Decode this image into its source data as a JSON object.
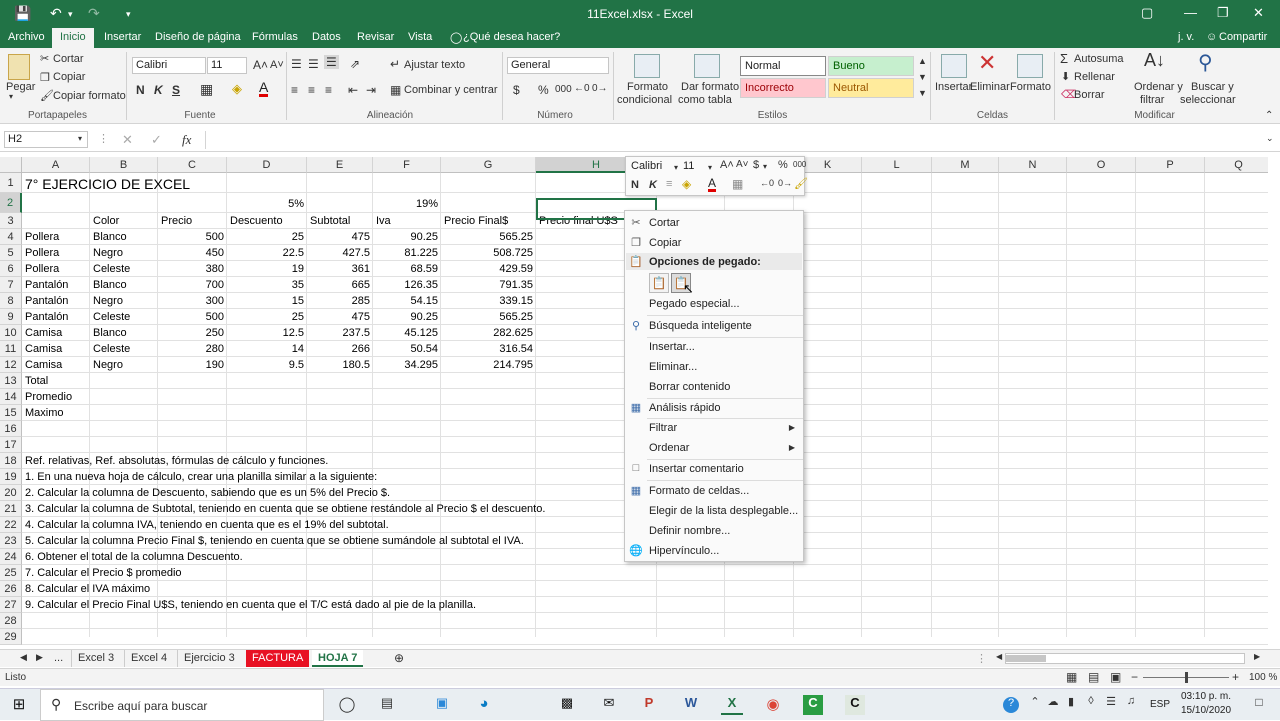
{
  "title_bar": {
    "title": "11Excel.xlsx - Excel"
  },
  "tabs": [
    "Archivo",
    "Inicio",
    "Insertar",
    "Diseño de página",
    "Fórmulas",
    "Datos",
    "Revisar",
    "Vista"
  ],
  "tell_me": "¿Qué desea hacer?",
  "user": "j. v.",
  "share": "Compartir",
  "ribbon": {
    "clipboard": {
      "paste": "Pegar",
      "cut": "Cortar",
      "copy": "Copiar",
      "format_painter": "Copiar formato",
      "group": "Portapapeles"
    },
    "font": {
      "name": "Calibri",
      "size": "11",
      "bold": "N",
      "italic": "K",
      "underline": "S",
      "group": "Fuente"
    },
    "alignment": {
      "wrap": "Ajustar texto",
      "merge": "Combinar y centrar",
      "group": "Alineación"
    },
    "number": {
      "format": "General",
      "currency": "$",
      "percent": "%",
      "thousands": "000",
      "group": "Número"
    },
    "styles": {
      "conditional": [
        "Formato",
        "condicional"
      ],
      "as_table": [
        "Dar formato",
        "como tabla"
      ],
      "normal": "Normal",
      "bueno": "Bueno",
      "incorrecto": "Incorrecto",
      "neutral": "Neutral",
      "group": "Estilos"
    },
    "cells": {
      "insert": "Insertar",
      "delete": "Eliminar",
      "format": "Formato",
      "group": "Celdas"
    },
    "editing": {
      "autosum": "Autosuma",
      "fill": "Rellenar",
      "clear": "Borrar",
      "sort": [
        "Ordenar y",
        "filtrar"
      ],
      "find": [
        "Buscar y",
        "seleccionar"
      ],
      "group": "Modificar"
    }
  },
  "formula_bar": {
    "name_box": "H2",
    "fx": "fx",
    "value": ""
  },
  "columns": [
    "A",
    "B",
    "C",
    "D",
    "E",
    "F",
    "G",
    "H",
    "I",
    "J",
    "K",
    "L",
    "M",
    "N",
    "O",
    "P",
    "Q"
  ],
  "rows": [
    "1",
    "2",
    "3",
    "4",
    "5",
    "6",
    "7",
    "8",
    "9",
    "10",
    "11",
    "12",
    "13",
    "14",
    "15",
    "16",
    "17",
    "18",
    "19",
    "20",
    "21",
    "22",
    "23",
    "24",
    "25",
    "26",
    "27",
    "28",
    "29"
  ],
  "cells": {
    "A1": "7° EJERCICIO DE EXCEL",
    "D2": "5%",
    "F2": "19%",
    "B3": "Color",
    "C3": "Precio",
    "D3": "Descuento",
    "E3": "Subtotal",
    "F3": "Iva",
    "G3": "Precio Final$",
    "H3": "Precio final U$S",
    "data": [
      [
        "Pollera",
        "Blanco",
        "500",
        "25",
        "475",
        "90.25",
        "565.25"
      ],
      [
        "Pollera",
        "Negro",
        "450",
        "22.5",
        "427.5",
        "81.225",
        "508.725"
      ],
      [
        "Pollera",
        "Celeste",
        "380",
        "19",
        "361",
        "68.59",
        "429.59"
      ],
      [
        "Pantalón",
        "Blanco",
        "700",
        "35",
        "665",
        "126.35",
        "791.35"
      ],
      [
        "Pantalón",
        "Negro",
        "300",
        "15",
        "285",
        "54.15",
        "339.15"
      ],
      [
        "Pantalón",
        "Celeste",
        "500",
        "25",
        "475",
        "90.25",
        "565.25"
      ],
      [
        "Camisa",
        "Blanco",
        "250",
        "12.5",
        "237.5",
        "45.125",
        "282.625"
      ],
      [
        "Camisa",
        "Celeste",
        "280",
        "14",
        "266",
        "50.54",
        "316.54"
      ],
      [
        "Camisa",
        "Negro",
        "190",
        "9.5",
        "180.5",
        "34.295",
        "214.795"
      ]
    ],
    "A13": "Total",
    "A14": "Promedio",
    "A15": "Maximo",
    "notes": [
      "Ref. relativas, Ref. absolutas, fórmulas de cálculo y funciones.",
      "1. En una nueva hoja de cálculo, crear una planilla similar a la siguiente:",
      "2. Calcular la columna de Descuento, sabiendo que es un 5% del Precio $.",
      "3. Calcular la columna de Subtotal, teniendo en cuenta que se obtiene restándole al Precio $ el descuento.",
      "4. Calcular la columna IVA, teniendo en cuenta que es el 19% del subtotal.",
      "5. Calcular la columna Precio Final $, teniendo en cuenta que se obtiene sumándole al subtotal el IVA.",
      "6. Obtener el total de la columna Descuento.",
      "7. Calcular el Precio $ promedio",
      "8. Calcular el IVA máximo",
      "9. Calcular el Precio Final U$S, teniendo en cuenta que el T/C está dado al pie de la planilla."
    ]
  },
  "mini_toolbar": {
    "font": "Calibri",
    "size": "11"
  },
  "context_menu": {
    "cut": "Cortar",
    "copy": "Copiar",
    "paste_options": "Opciones de pegado:",
    "paste_special": "Pegado especial...",
    "smart_lookup": "Búsqueda inteligente",
    "insert": "Insertar...",
    "delete": "Eliminar...",
    "clear": "Borrar contenido",
    "quick_analysis": "Análisis rápido",
    "filter": "Filtrar",
    "sort": "Ordenar",
    "insert_comment": "Insertar comentario",
    "format_cells": "Formato de celdas...",
    "pick_list": "Elegir de la lista desplegable...",
    "define_name": "Definir nombre...",
    "hyperlink": "Hipervínculo..."
  },
  "sheet_tabs": [
    "...",
    "Excel 3",
    "Excel 4",
    "Ejercicio 3",
    "FACTURA",
    "HOJA 7"
  ],
  "status": {
    "ready": "Listo",
    "zoom": "100 %"
  },
  "taskbar": {
    "search": "Escribe aquí para buscar",
    "lang": "ESP",
    "time": "03:10 p. m.",
    "date": "15/10/2020"
  },
  "colors": {
    "excel_green": "#217346",
    "factura_tab": "#e81123"
  }
}
